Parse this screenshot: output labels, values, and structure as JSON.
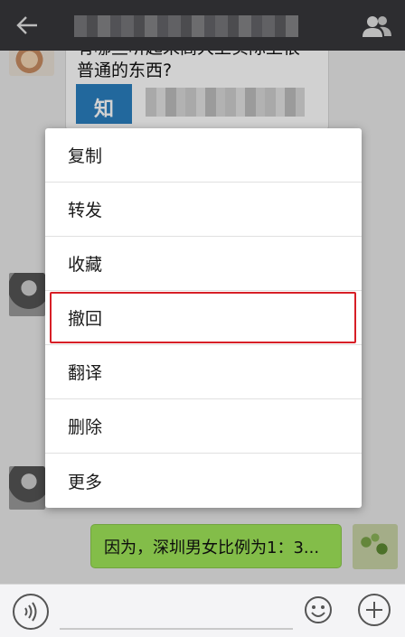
{
  "chat": {
    "shared_card": {
      "title_line1": "有哪些听起来高大上实际上很",
      "title_line2": "普通的东西?",
      "thumb_text": "知"
    },
    "outgoing_message": "因为，深圳男女比例为1：3..."
  },
  "context_menu": {
    "items": [
      {
        "label": "复制"
      },
      {
        "label": "转发"
      },
      {
        "label": "收藏"
      },
      {
        "label": "撤回"
      },
      {
        "label": "翻译"
      },
      {
        "label": "删除"
      },
      {
        "label": "更多"
      }
    ],
    "highlighted_item": "撤回",
    "highlight_color": "#d71f27"
  },
  "colors": {
    "topbar": "#37373b",
    "outgoing_bubble": "#a0e759",
    "chat_background": "#ebebeb"
  },
  "icons": {
    "back": "back-arrow-icon",
    "contacts": "contacts-icon",
    "voice": "voice-icon",
    "emoji": "emoji-icon",
    "plus": "plus-icon"
  }
}
